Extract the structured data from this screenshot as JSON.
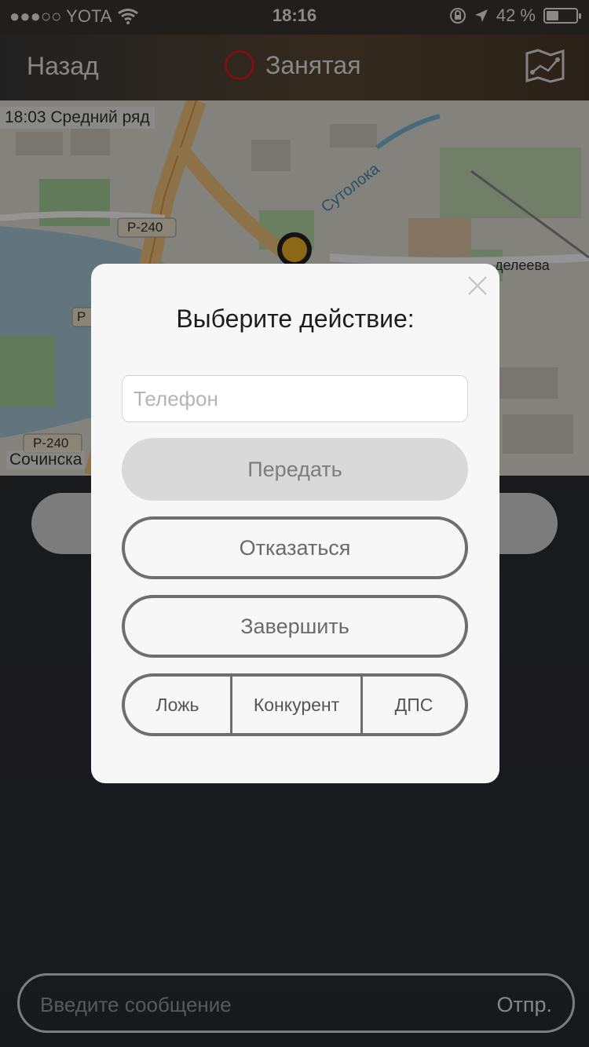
{
  "status_bar": {
    "carrier": "●●●○○ YOTA",
    "time": "18:16",
    "battery_percent": "42 %",
    "battery_level": 0.42,
    "icons": [
      "wifi-icon",
      "rotation-lock-icon",
      "location-arrow-icon",
      "battery-icon"
    ]
  },
  "navbar": {
    "back_label": "Назад",
    "title": "Занятая",
    "status_ring_color": "#d81e1e",
    "map_icon": "map-icon"
  },
  "map": {
    "top_label": "18:03 Средний ряд",
    "bottom_label": "Сочинска",
    "road_labels": [
      "Р-240",
      "Р",
      "Р-240"
    ],
    "street_labels": [
      "Сутолока",
      "делеева"
    ]
  },
  "message_bar": {
    "placeholder": "Введите сообщение",
    "send_label": "Отпр."
  },
  "modal": {
    "title": "Выберите действие:",
    "phone_placeholder": "Телефон",
    "transfer_label": "Передать",
    "refuse_label": "Отказаться",
    "finish_label": "Завершить",
    "options": [
      "Ложь",
      "Конкурент",
      "ДПС"
    ]
  }
}
